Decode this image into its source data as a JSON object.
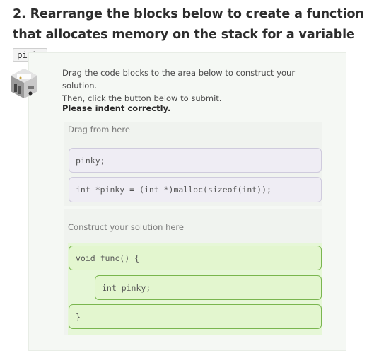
{
  "question": {
    "title": "2. Rearrange the blocks below to create a function that allocates memory on the stack for a variable",
    "variable": "pinky"
  },
  "instructions": {
    "line1": "Drag the code blocks to the area below to construct your solution.",
    "line2": "Then, click the button below to submit.",
    "indent_note": "Please indent correctly."
  },
  "drag_zone": {
    "label": "Drag from here",
    "blocks": [
      "pinky;",
      "int *pinky = (int *)malloc(sizeof(int));"
    ]
  },
  "drop_zone": {
    "label": "Construct your solution here",
    "blocks": [
      "void func() {",
      "int pinky;",
      "}"
    ],
    "indent_levels": [
      0,
      1,
      0
    ]
  },
  "colors": {
    "source_block_bg": "#efedf4",
    "placed_block_bg": "#e3f6cf",
    "placed_block_border": "#7ab64f"
  },
  "icons": {
    "avatar": "code-cube-icon"
  }
}
